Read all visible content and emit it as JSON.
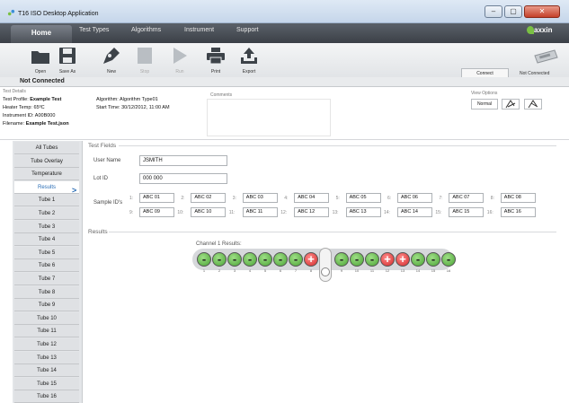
{
  "window": {
    "title": "T16 ISO Desktop Application",
    "min": "–",
    "max": "▢",
    "close": "✕"
  },
  "menu": {
    "items": [
      "Home",
      "Test Types",
      "Algorithms",
      "Instrument",
      "Support"
    ],
    "logo": "axxin"
  },
  "toolbar": {
    "open": "Open",
    "save_as": "Save As",
    "new": "New",
    "stop": "Stop",
    "run": "Run",
    "print": "Print",
    "export": "Export",
    "connect": "Connect",
    "not_connected": "Not Connected"
  },
  "status": {
    "text": "Not Connected"
  },
  "details": {
    "heading": "Test Details",
    "profile_label": "Test Profile:",
    "profile": "Example Test",
    "heater_label": "Heater Temp:",
    "heater": "65ºC",
    "instrument_label": "Instrument ID:",
    "instrument": "A00B000",
    "filename_label": "Filename:",
    "filename": "Example Test.json",
    "algorithm_label": "Algorithm:",
    "algorithm": "Algorithm Type01",
    "start_label": "Start Time:",
    "start": "30/12/2012, 11:00 AM",
    "comments_heading": "Comments",
    "view_heading": "View Options",
    "view_normal": "Normal"
  },
  "sidebar": {
    "items": [
      "All Tubes",
      "Tube Overlay",
      "Temperature",
      "Results",
      "Tube 1",
      "Tube 2",
      "Tube 3",
      "Tube 4",
      "Tube 5",
      "Tube 6",
      "Tube 7",
      "Tube 8",
      "Tube 9",
      "Tube 10",
      "Tube 11",
      "Tube 12",
      "Tube 13",
      "Tube 14",
      "Tube 15",
      "Tube 16"
    ],
    "active_index": 3
  },
  "test_fields": {
    "heading": "Test Fields",
    "user_name_label": "User Name",
    "user_name": "JSMITH",
    "lot_id_label": "Lot ID",
    "lot_id": "000 000",
    "sample_ids_label": "Sample ID's",
    "sample_ids": [
      "ABC 01",
      "ABC 02",
      "ABC 03",
      "ABC 04",
      "ABC 05",
      "ABC 06",
      "ABC 07",
      "ABC 08",
      "ABC 09",
      "ABC 10",
      "ABC 11",
      "ABC 12",
      "ABC 13",
      "ABC 14",
      "ABC 15",
      "ABC 16"
    ]
  },
  "results": {
    "heading": "Results",
    "channel_label": "Channel 1 Results:",
    "tubes": [
      "-",
      "-",
      "-",
      "-",
      "-",
      "-",
      "-",
      "+",
      "-",
      "-",
      "-",
      "+",
      "+",
      "-",
      "-",
      "-"
    ]
  }
}
